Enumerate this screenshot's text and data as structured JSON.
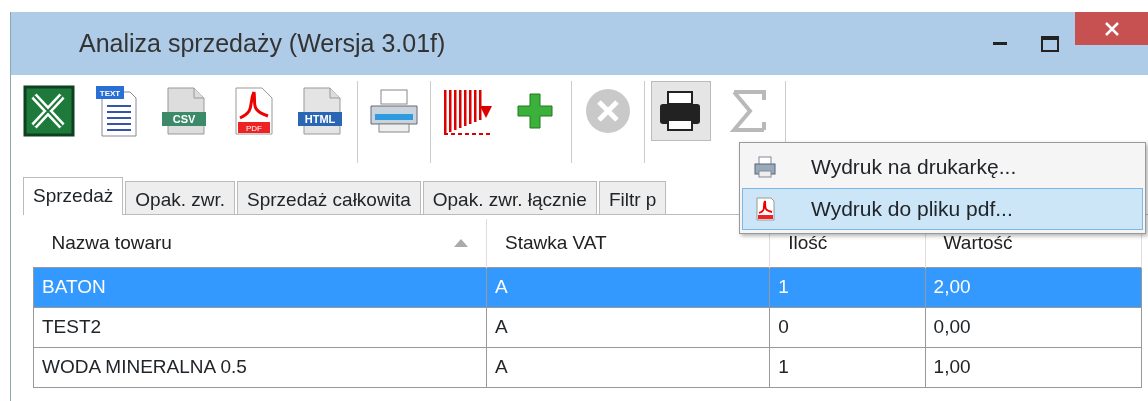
{
  "window": {
    "title": "Analiza sprzedaży (Wersja 3.01f)"
  },
  "toolbar": [
    [
      {
        "kind": "excel",
        "disabled": false,
        "pressed": false
      },
      {
        "kind": "text",
        "label": "TEXT",
        "disabled": false,
        "pressed": false
      },
      {
        "kind": "csv",
        "label": "CSV",
        "disabled": false,
        "pressed": false
      },
      {
        "kind": "pdf",
        "label": "PDF",
        "disabled": false,
        "pressed": false
      },
      {
        "kind": "html",
        "label": "HTML",
        "disabled": false,
        "pressed": false
      }
    ],
    [
      {
        "kind": "printer",
        "disabled": false,
        "pressed": false
      }
    ],
    [
      {
        "kind": "bars",
        "disabled": false,
        "pressed": false
      },
      {
        "kind": "plus",
        "disabled": false,
        "pressed": false
      }
    ],
    [
      {
        "kind": "cancel",
        "disabled": true,
        "pressed": false
      }
    ],
    [
      {
        "kind": "printer_dark",
        "disabled": false,
        "pressed": true
      },
      {
        "kind": "sigma",
        "disabled": true,
        "pressed": false
      }
    ]
  ],
  "tabs": [
    {
      "label": "Sprzedaż",
      "selected": true
    },
    {
      "label": "Opak. zwr.",
      "selected": false
    },
    {
      "label": "Sprzedaż całkowita",
      "selected": false
    },
    {
      "label": "Opak. zwr. łącznie",
      "selected": false
    },
    {
      "label": "Filtr p",
      "selected": false
    }
  ],
  "menu": [
    {
      "kind": "printer",
      "label": "Wydruk na drukarkę...",
      "selected": false
    },
    {
      "kind": "pdf",
      "label": "Wydruk do pliku pdf...",
      "selected": true
    }
  ],
  "table": {
    "columns": [
      {
        "label": "Nazwa towaru",
        "sorted": true
      },
      {
        "label": "Stawka VAT",
        "sorted": false
      },
      {
        "label": "Ilość",
        "sorted": false
      },
      {
        "label": "Wartość",
        "sorted": false
      }
    ],
    "rows": [
      {
        "cells": [
          "BATON",
          "A",
          "1",
          "2,00"
        ],
        "selected": true
      },
      {
        "cells": [
          "TEST2",
          "A",
          "0",
          "0,00"
        ],
        "selected": false
      },
      {
        "cells": [
          "WODA MINERALNA 0.5",
          "A",
          "1",
          "1,00"
        ],
        "selected": false
      }
    ]
  }
}
